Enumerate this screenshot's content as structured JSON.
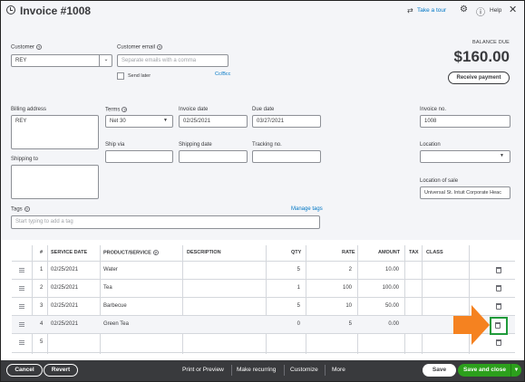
{
  "header": {
    "title": "Invoice #1008",
    "tour": "Take a tour",
    "help": "Help"
  },
  "balance": {
    "label": "BALANCE DUE",
    "amount": "$160.00",
    "receive_button": "Receive payment"
  },
  "customer": {
    "label": "Customer",
    "value": "REY"
  },
  "email": {
    "label": "Customer email",
    "placeholder": "Separate emails with a comma",
    "send_later": "Send later",
    "ccbcc": "Cc/Bcc"
  },
  "billing": {
    "label": "Billing address",
    "value": "REY"
  },
  "shipping_to": {
    "label": "Shipping to"
  },
  "terms": {
    "label": "Terms",
    "value": "Net 30"
  },
  "invoice_date": {
    "label": "Invoice date",
    "value": "02/25/2021"
  },
  "due_date": {
    "label": "Due date",
    "value": "03/27/2021"
  },
  "invoice_no": {
    "label": "Invoice no.",
    "value": "1008"
  },
  "ship_via": {
    "label": "Ship via"
  },
  "shipping_date": {
    "label": "Shipping date"
  },
  "tracking_no": {
    "label": "Tracking no."
  },
  "location": {
    "label": "Location"
  },
  "location_of_sale": {
    "label": "Location of sale",
    "value": "Universal St. Intuit Corporate Heac"
  },
  "tags": {
    "label": "Tags",
    "placeholder": "Start typing to add a tag",
    "manage": "Manage tags"
  },
  "table": {
    "columns": [
      "#",
      "SERVICE DATE",
      "PRODUCT/SERVICE",
      "DESCRIPTION",
      "QTY",
      "RATE",
      "AMOUNT",
      "TAX",
      "CLASS"
    ],
    "rows": [
      {
        "num": "1",
        "date": "02/25/2021",
        "product": "Water",
        "qty": "5",
        "rate": "2",
        "amount": "10.00"
      },
      {
        "num": "2",
        "date": "02/25/2021",
        "product": "Tea",
        "qty": "1",
        "rate": "100",
        "amount": "100.00"
      },
      {
        "num": "3",
        "date": "02/25/2021",
        "product": "Barbecue",
        "qty": "5",
        "rate": "10",
        "amount": "50.00"
      },
      {
        "num": "4",
        "date": "02/25/2021",
        "product": "Green Tea",
        "qty": "0",
        "rate": "5",
        "amount": "0.00"
      },
      {
        "num": "5",
        "date": "",
        "product": "",
        "qty": "",
        "rate": "",
        "amount": ""
      }
    ]
  },
  "footer": {
    "cancel": "Cancel",
    "revert": "Revert",
    "print": "Print or Preview",
    "recurring": "Make recurring",
    "customize": "Customize",
    "more": "More",
    "save": "Save",
    "save_close": "Save and close"
  },
  "colors": {
    "accent_green": "#2ca01c",
    "link_blue": "#0077c5",
    "pointer_orange": "#f58220",
    "highlight_green": "#1f9a3a"
  }
}
